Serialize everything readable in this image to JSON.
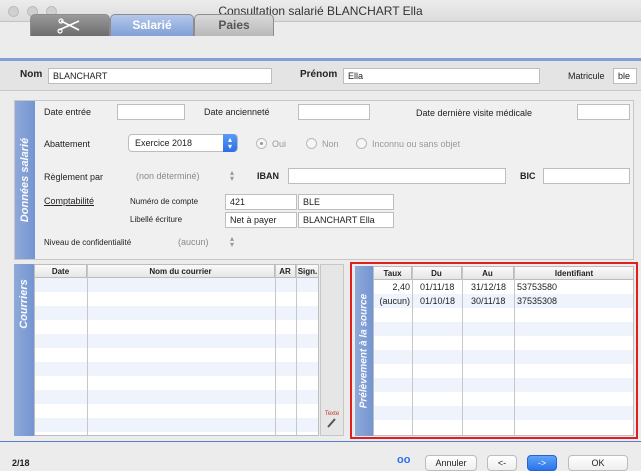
{
  "window": {
    "title": "Consultation salarié BLANCHART Ella"
  },
  "tabs": [
    {
      "label": "",
      "icon": "scissors-icon"
    },
    {
      "label": "Salarié"
    },
    {
      "label": "Paies"
    }
  ],
  "header": {
    "nom_label": "Nom",
    "nom_value": "BLANCHART",
    "prenom_label": "Prénom",
    "prenom_value": "Ella",
    "matricule_label": "Matricule",
    "matricule_value": "ble"
  },
  "donnees": {
    "section_title": "Données salarié",
    "date_entree_label": "Date entrée",
    "date_entree_value": "",
    "date_anciennete_label": "Date ancienneté",
    "date_anciennete_value": "",
    "visite_label": "Date dernière visite médicale",
    "visite_value": "",
    "abattement_label": "Abattement",
    "abattement_value": "Exercice 2018",
    "radio_oui": "Oui",
    "radio_non": "Non",
    "radio_inconnu": "Inconnu ou sans objet",
    "reglement_label": "Règlement par",
    "reglement_value": "(non déterminé)",
    "iban_label": "IBAN",
    "iban_value": "",
    "bic_label": "BIC",
    "bic_value": "",
    "comptabilite_label": "Comptabilité",
    "numero_compte_label": "Numéro de compte",
    "numero_compte_value": "421",
    "numero_compte_suffix": "BLE",
    "libelle_label": "Libellé écriture",
    "libelle_value": "Net à payer",
    "libelle_name": "BLANCHART Ella",
    "confidentialite_label": "Niveau de confidentialité",
    "confidentialite_value": "(aucun)"
  },
  "courriers": {
    "section_title": "Courriers",
    "columns": [
      "Date",
      "Nom du courrier",
      "AR",
      "Sign."
    ],
    "rows": [],
    "texte_button": "Texte"
  },
  "prelevement": {
    "section_title": "Prélèvement à la source",
    "columns": [
      "Taux",
      "Du",
      "Au",
      "Identifiant"
    ],
    "rows": [
      {
        "taux": "2,40",
        "du": "01/11/18",
        "au": "31/12/18",
        "identifiant": "53753580"
      },
      {
        "taux": "(aucun)",
        "du": "01/10/18",
        "au": "30/11/18",
        "identifiant": "37535308"
      }
    ]
  },
  "footer": {
    "record_position": "2/18",
    "annuler_label": "Annuler",
    "prev_label": "<-",
    "next_label": "->",
    "ok_label": "OK"
  },
  "colors": {
    "accent": "#7f9fd6",
    "highlight": "#e02020",
    "primary_button": "#2b72ea"
  }
}
